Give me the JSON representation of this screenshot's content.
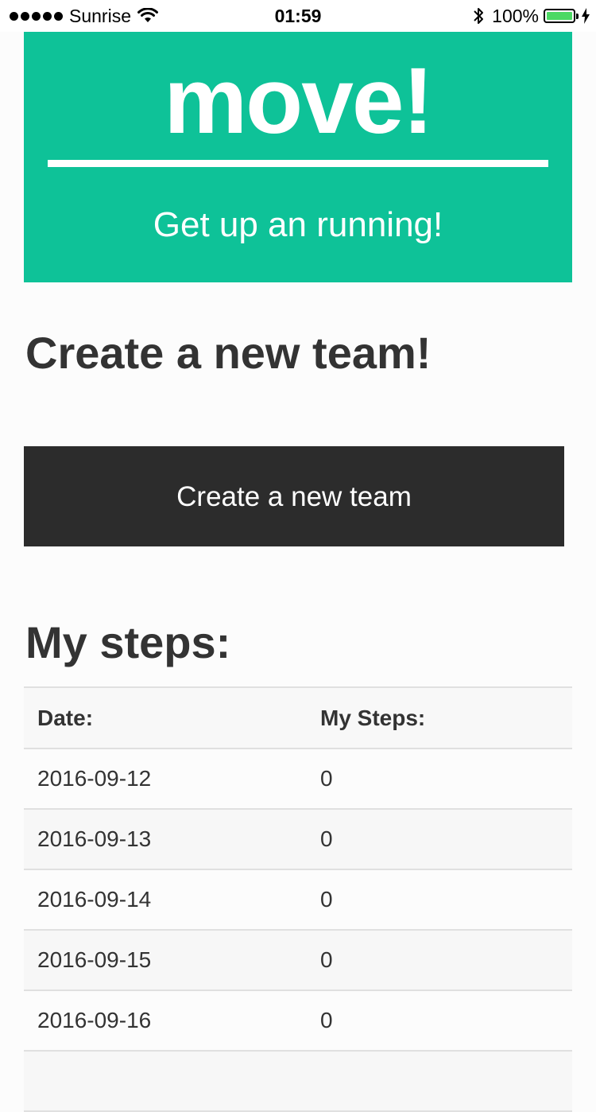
{
  "status_bar": {
    "carrier": "Sunrise",
    "time": "01:59",
    "battery_percent": "100%",
    "battery_level": 1.0,
    "signal_bars": 5,
    "icons": [
      "signal-dots-icon",
      "wifi-icon",
      "bluetooth-icon",
      "battery-icon",
      "charging-icon"
    ]
  },
  "hero": {
    "title": "move!",
    "subtitle": "Get up an running!",
    "background_color": "#0ec298"
  },
  "create_section": {
    "title": "Create a new team!",
    "button_label": "Create a new team",
    "button_color": "#2c2c2c"
  },
  "steps_section": {
    "title": "My steps:",
    "columns": [
      "Date:",
      "My Steps:"
    ],
    "rows": [
      {
        "date": "2016-09-12",
        "steps": "0"
      },
      {
        "date": "2016-09-13",
        "steps": "0"
      },
      {
        "date": "2016-09-14",
        "steps": "0"
      },
      {
        "date": "2016-09-15",
        "steps": "0"
      },
      {
        "date": "2016-09-16",
        "steps": "0"
      }
    ]
  }
}
